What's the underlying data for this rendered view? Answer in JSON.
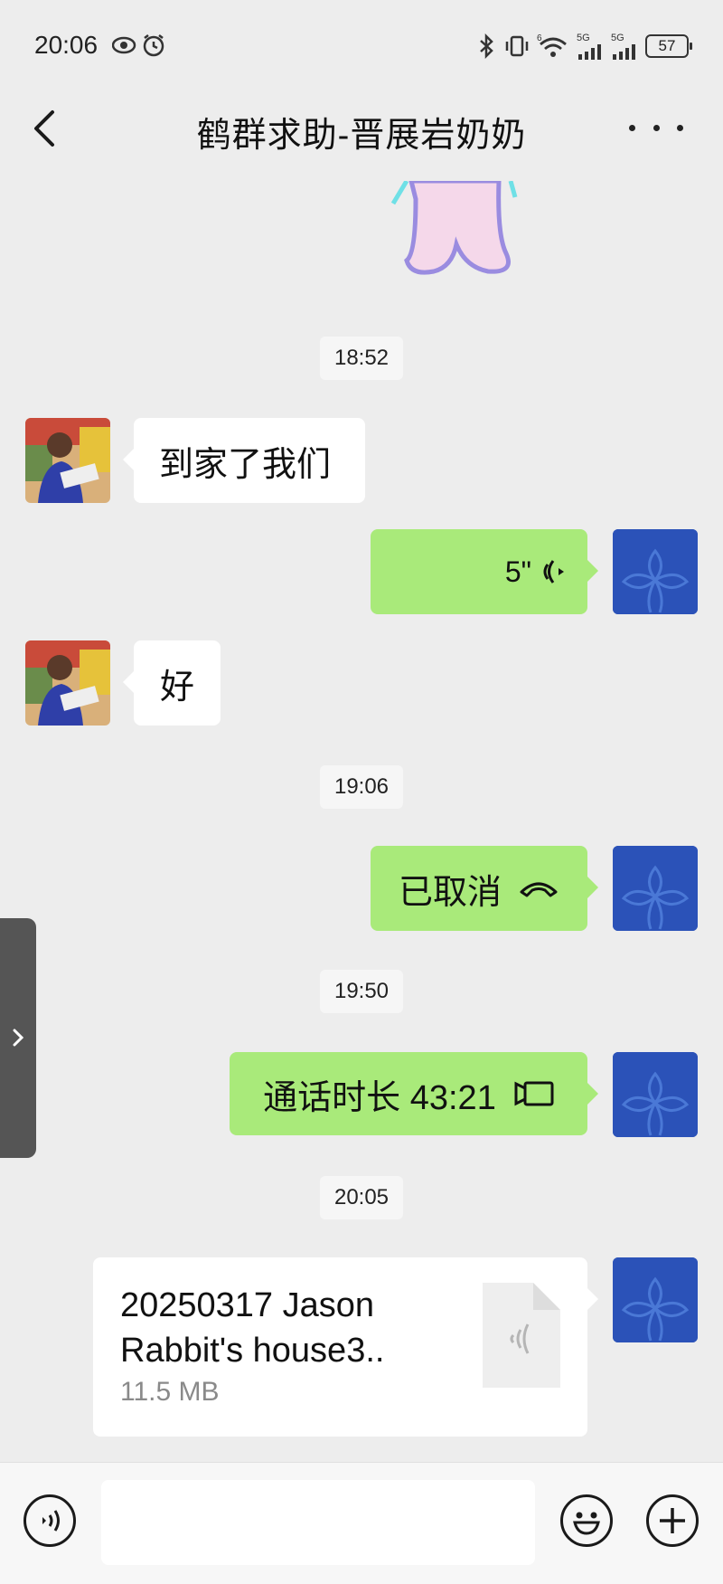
{
  "status_bar": {
    "time": "20:06",
    "network_1": "5G",
    "network_2": "5G",
    "wifi_badge": "6",
    "battery": "57"
  },
  "header": {
    "title": "鹤群求助-晋展岩奶奶"
  },
  "messages": [
    {
      "type": "timestamp",
      "text": "18:52"
    },
    {
      "type": "text",
      "from": "other",
      "text": "到家了我们"
    },
    {
      "type": "voice",
      "from": "me",
      "duration": "5\""
    },
    {
      "type": "text",
      "from": "other",
      "text": "好"
    },
    {
      "type": "timestamp",
      "text": "19:06"
    },
    {
      "type": "call",
      "from": "me",
      "text": "已取消"
    },
    {
      "type": "timestamp",
      "text": "19:50"
    },
    {
      "type": "video_call",
      "from": "me",
      "text": "通话时长 43:21"
    },
    {
      "type": "timestamp",
      "text": "20:05"
    },
    {
      "type": "file",
      "from": "me",
      "name_line1": "20250317 Jason",
      "name_line2": "Rabbit's house3..",
      "size": "11.5 MB"
    }
  ],
  "input": {
    "placeholder": ""
  },
  "colors": {
    "background": "#ededed",
    "bubble_green": "#a9ea7a",
    "bubble_white": "#ffffff",
    "avatar_me": "#2b52b8"
  },
  "icons": {
    "back": "chevron-left-icon",
    "more": "more-icon",
    "voice_mode": "voice-mode-icon",
    "emoji": "emoji-icon",
    "plus": "plus-icon",
    "audio_file": "audio-file-icon"
  }
}
